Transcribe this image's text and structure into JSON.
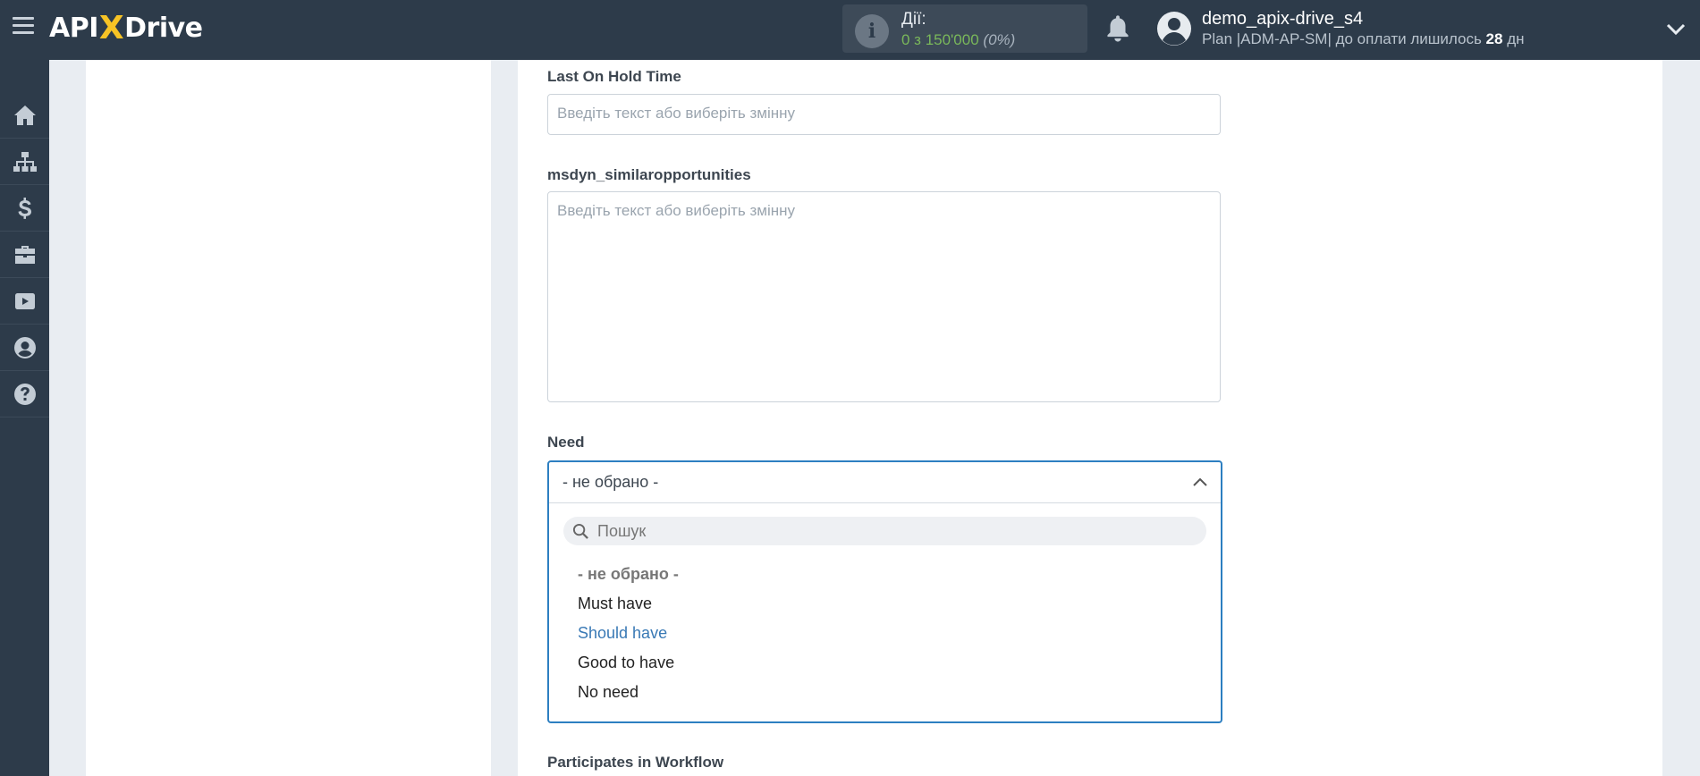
{
  "header": {
    "logo": {
      "part1": "API",
      "part2": "X",
      "part3": "Drive"
    },
    "actions": {
      "title": "Дії:",
      "value": "0 з 150'000",
      "percent": "(0%)"
    },
    "user": {
      "name": "demo_apix-drive_s4",
      "plan_prefix": "Plan |ADM-AP-SM| до оплати лишилось ",
      "days": "28",
      "plan_suffix": " дн"
    }
  },
  "sidebar": {
    "items": [
      "home-icon",
      "sitemap-icon",
      "dollar-icon",
      "briefcase-icon",
      "youtube-icon",
      "user-circle-icon",
      "question-icon"
    ]
  },
  "form": {
    "last_on_hold": {
      "label": "Last On Hold Time",
      "placeholder": "Введіть текст або виберіть змінну"
    },
    "similar_opps": {
      "label": "msdyn_similaropportunities",
      "placeholder": "Введіть текст або виберіть змінну"
    },
    "need": {
      "label": "Need",
      "selected": "- не обрано -",
      "search_placeholder": "Пошук",
      "options": [
        "- не обрано -",
        "Must have",
        "Should have",
        "Good to have",
        "No need"
      ]
    },
    "participates": {
      "label": "Participates in Workflow"
    }
  },
  "colors": {
    "topbar": "#2d3b4a",
    "accent_blue": "#2d7fc1",
    "hover_option": "#3979b5",
    "actions_value": "#7ab85a",
    "logo_x": "#f7c325"
  }
}
